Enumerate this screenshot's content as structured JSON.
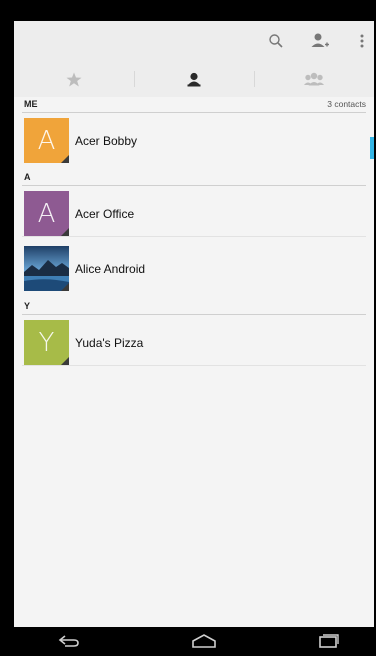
{
  "action_bar": {
    "icons": [
      "search-icon",
      "add-contact-icon",
      "overflow-menu-icon"
    ]
  },
  "tabs": [
    {
      "icon": "star-icon",
      "selected": false
    },
    {
      "icon": "person-icon",
      "selected": true
    },
    {
      "icon": "group-icon",
      "selected": false
    }
  ],
  "sections": {
    "me": {
      "label": "ME",
      "count": "3 contacts"
    },
    "a": {
      "label": "A"
    },
    "y": {
      "label": "Y"
    }
  },
  "contacts": [
    {
      "name": "Acer Bobby",
      "initial": "A",
      "color": "#f0a43a"
    },
    {
      "name": "Acer Office",
      "initial": "A",
      "color": "#8e5a92"
    },
    {
      "name": "Alice Android",
      "initial": "",
      "color": "#3b6a9a",
      "photo": "landscape-photo"
    },
    {
      "name": "Yuda's Pizza",
      "initial": "Y",
      "color": "#a7bb48"
    }
  ],
  "colors": {
    "accent": "#33b5e5",
    "background": "#f4f4f4"
  },
  "nav": {
    "icons": [
      "back-icon",
      "home-icon",
      "recent-apps-icon"
    ]
  }
}
